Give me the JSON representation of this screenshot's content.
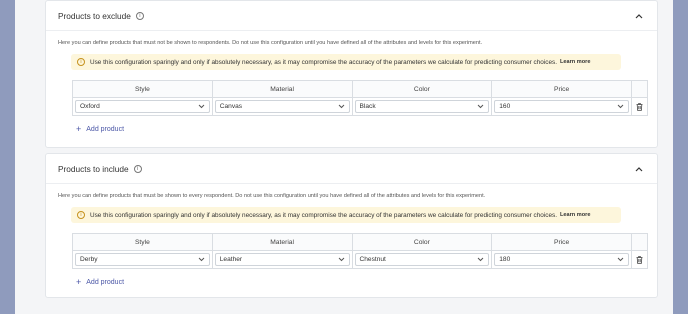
{
  "exclude": {
    "title": "Products to exclude",
    "description": "Here you can define products that must not be shown to respondents. Do not use this configuration until you have defined all of the attributes and levels for this experiment.",
    "warning": "Use this configuration sparingly and only if absolutely necessary, as it may compromise the accuracy of the parameters we calculate for predicting consumer choices.",
    "learn_more": "Learn more",
    "columns": [
      "Style",
      "Material",
      "Color",
      "Price"
    ],
    "row": {
      "style": "Oxford",
      "material": "Canvas",
      "color": "Black",
      "price": "160"
    },
    "add_label": "Add product"
  },
  "include": {
    "title": "Products to include",
    "description": "Here you can define products that must be shown to every respondent. Do not use this configuration until you have defined all of the attributes and levels for this experiment.",
    "warning": "Use this configuration sparingly and only if absolutely necessary, as it may compromise the accuracy of the parameters we calculate for predicting consumer choices.",
    "learn_more": "Learn more",
    "columns": [
      "Style",
      "Material",
      "Color",
      "Price"
    ],
    "row": {
      "style": "Derby",
      "material": "Leather",
      "color": "Chestnut",
      "price": "180"
    },
    "add_label": "Add product"
  },
  "icons": {
    "info": "info-icon",
    "collapse": "chevron-up-icon",
    "warning": "warning-icon",
    "dropdown": "chevron-down-icon",
    "delete": "trash-icon",
    "add": "plus-icon"
  },
  "colors": {
    "accent": "#4a56a6",
    "warning_bg": "#fdf6dc",
    "warning_icon": "#c6921e"
  }
}
